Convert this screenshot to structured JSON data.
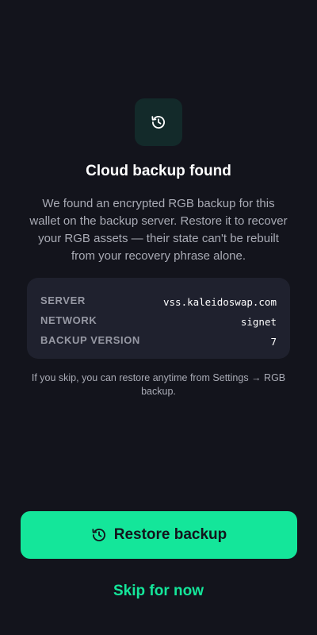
{
  "header": {
    "icon": "restore-history-icon",
    "title": "Cloud backup found",
    "description": "We found an encrypted RGB backup for this wallet on the backup server. Restore it to recover your RGB assets — their state can't be rebuilt from your recovery phrase alone."
  },
  "backup_info": {
    "rows": [
      {
        "label": "SERVER",
        "value": "vss.kaleidoswap.com"
      },
      {
        "label": "NETWORK",
        "value": "signet"
      },
      {
        "label": "BACKUP VERSION",
        "value": "7"
      }
    ]
  },
  "hint": "If you skip, you can restore anytime from Settings → RGB backup.",
  "actions": {
    "restore_label": "Restore backup",
    "restore_icon": "restore-history-icon",
    "skip_label": "Skip for now"
  },
  "colors": {
    "background": "#13141c",
    "accent": "#14e69a",
    "card": "#1f212e",
    "icon_tile": "#132a2a"
  }
}
